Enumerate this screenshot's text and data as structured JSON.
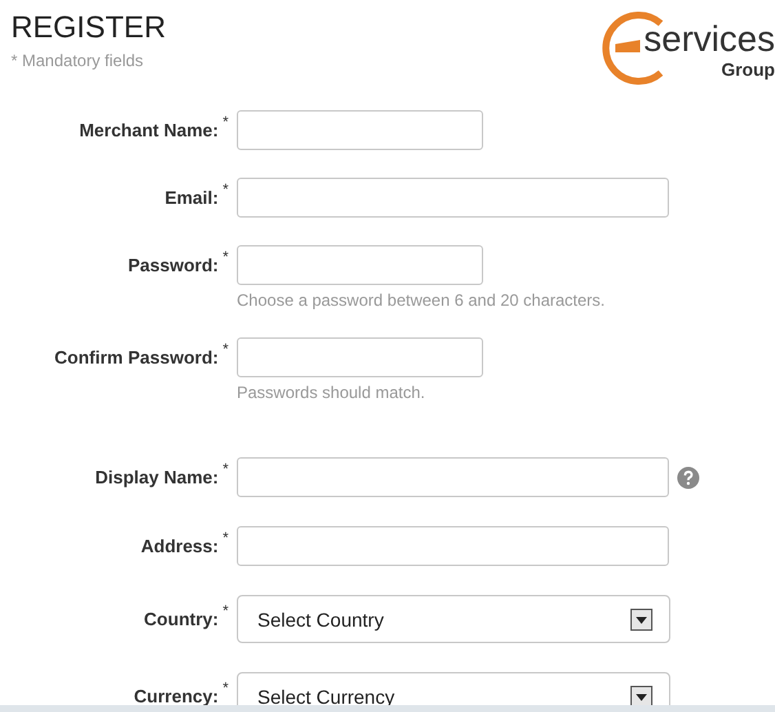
{
  "header": {
    "title": "REGISTER",
    "note": "* Mandatory fields"
  },
  "logo": {
    "word": "services",
    "sub": "Group"
  },
  "sections": [
    {
      "fields": [
        {
          "label": "Merchant Name:",
          "required": "*",
          "kind": "text",
          "wide": false
        },
        {
          "label": "Email:",
          "required": "*",
          "kind": "text",
          "wide": true
        },
        {
          "label": "Password:",
          "required": "*",
          "kind": "text",
          "wide": false,
          "hint": "Choose a password between 6 and 20 characters."
        },
        {
          "label": "Confirm Password:",
          "required": "*",
          "kind": "text",
          "wide": false,
          "hint": "Passwords should match."
        }
      ]
    },
    {
      "fields": [
        {
          "label": "Display Name:",
          "required": "*",
          "kind": "text",
          "wide": true,
          "help": true
        },
        {
          "label": "Address:",
          "required": "*",
          "kind": "text",
          "wide": true
        },
        {
          "label": "Country:",
          "required": "*",
          "kind": "select",
          "wide": true,
          "value": "Select Country"
        },
        {
          "label": "Currency:",
          "required": "*",
          "kind": "select",
          "wide": true,
          "value": "Select Currency"
        }
      ]
    }
  ]
}
